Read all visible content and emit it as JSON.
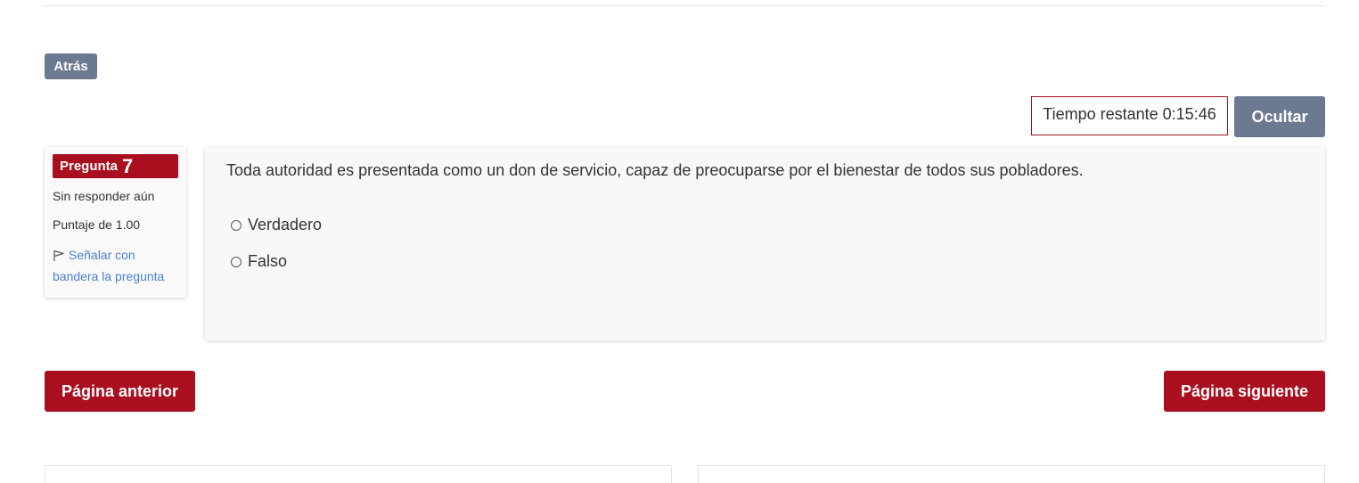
{
  "nav": {
    "back_label": "Atrás",
    "timer_text": "Tiempo restante 0:15:46",
    "hide_label": "Ocultar"
  },
  "question_info": {
    "label": "Pregunta",
    "number": "7",
    "state": "Sin responder aún",
    "grade": "Puntaje de 1.00",
    "flag_text": "Señalar con bandera la pregunta",
    "flag_icon": "flag-icon"
  },
  "question": {
    "text": "Toda autoridad es presentada como un don de servicio, capaz de preocuparse por el bienestar de todos sus pobladores.",
    "answers": [
      {
        "label": "Verdadero",
        "selected": false
      },
      {
        "label": "Falso",
        "selected": false
      }
    ]
  },
  "pagination": {
    "prev_label": "Página anterior",
    "next_label": "Página siguiente"
  },
  "colors": {
    "primary": "#a90f1f",
    "secondary": "#6b7a90",
    "link": "#4a7fd6"
  }
}
